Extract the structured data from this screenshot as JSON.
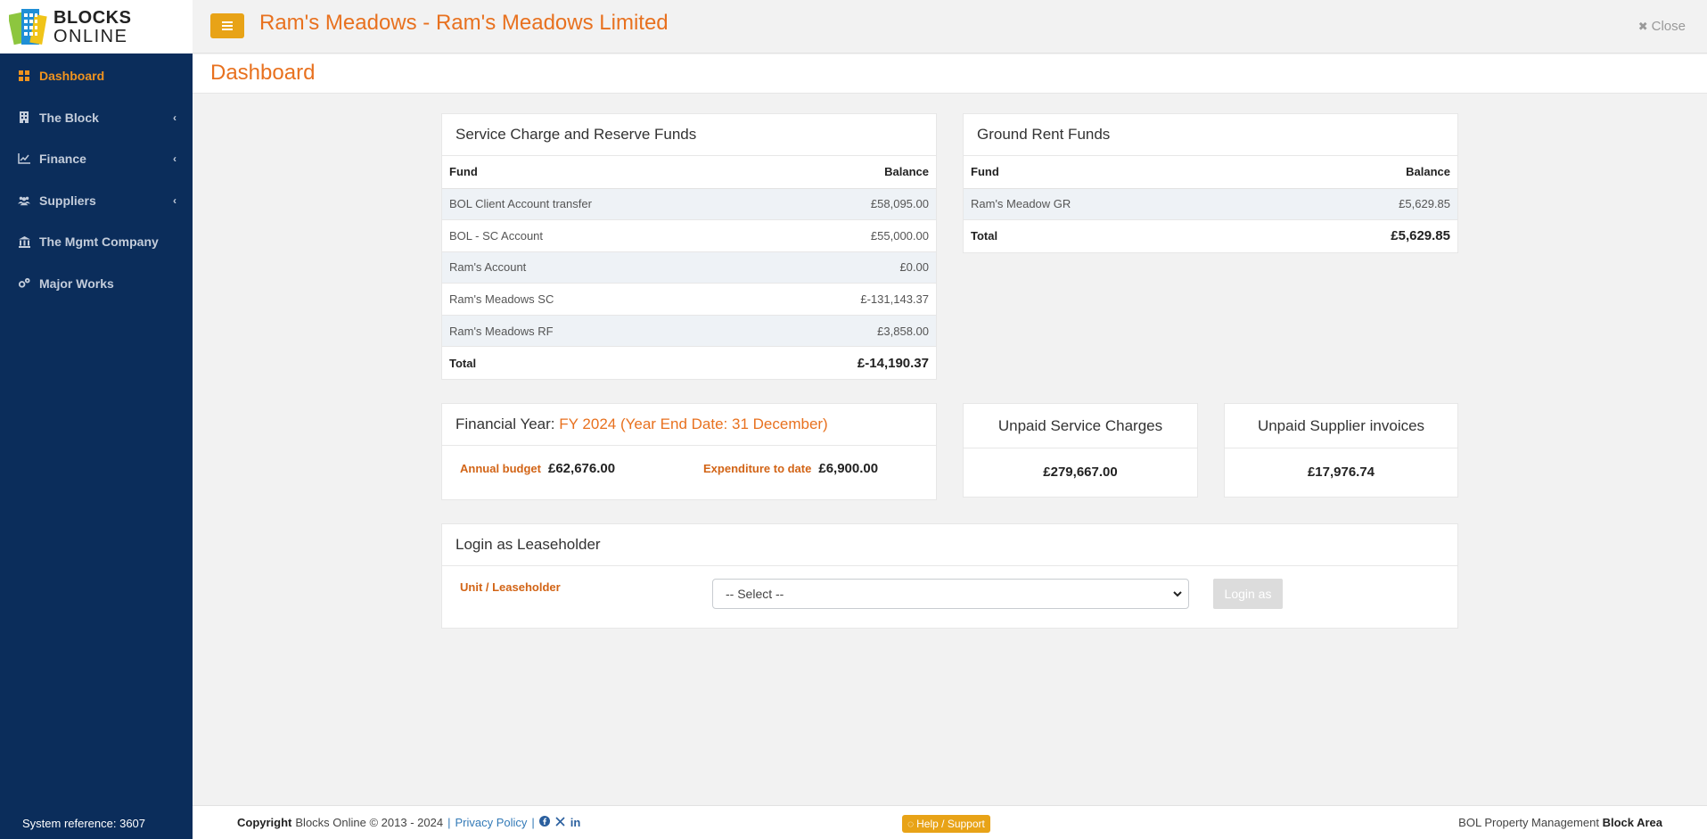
{
  "logo": {
    "line1": "BLOCKS",
    "line2": "ONLINE"
  },
  "sidebar": {
    "items": [
      {
        "label": "Dashboard",
        "icon": "grid-icon",
        "active": true
      },
      {
        "label": "The Block",
        "icon": "building-icon",
        "has_submenu": true
      },
      {
        "label": "Finance",
        "icon": "chart-icon",
        "has_submenu": true
      },
      {
        "label": "Suppliers",
        "icon": "users-icon",
        "has_submenu": true
      },
      {
        "label": "The Mgmt Company",
        "icon": "bank-icon"
      },
      {
        "label": "Major Works",
        "icon": "cogs-icon"
      }
    ],
    "system_reference": "System reference: 3607"
  },
  "header": {
    "title": "Ram's Meadows - Ram's Meadows Limited",
    "close_label": "Close"
  },
  "page_title": "Dashboard",
  "service_charge": {
    "title": "Service Charge and Reserve Funds",
    "col_fund": "Fund",
    "col_balance": "Balance",
    "rows": [
      {
        "fund": "BOL Client Account transfer",
        "balance": "£58,095.00"
      },
      {
        "fund": "BOL - SC Account",
        "balance": "£55,000.00"
      },
      {
        "fund": "Ram's Account",
        "balance": "£0.00"
      },
      {
        "fund": "Ram's Meadows SC",
        "balance": "£-131,143.37"
      },
      {
        "fund": "Ram's Meadows RF",
        "balance": "£3,858.00"
      }
    ],
    "total_label": "Total",
    "total_value": "£-14,190.37"
  },
  "ground_rent": {
    "title": "Ground Rent Funds",
    "col_fund": "Fund",
    "col_balance": "Balance",
    "rows": [
      {
        "fund": "Ram's Meadow GR",
        "balance": "£5,629.85"
      }
    ],
    "total_label": "Total",
    "total_value": "£5,629.85"
  },
  "financial_year": {
    "label": "Financial Year:",
    "value": "FY 2024 (Year End Date: 31 December)",
    "budget_label": "Annual budget",
    "budget_value": "£62,676.00",
    "expenditure_label": "Expenditure to date",
    "expenditure_value": "£6,900.00"
  },
  "unpaid_service": {
    "title": "Unpaid Service Charges",
    "value": "£279,667.00"
  },
  "unpaid_supplier": {
    "title": "Unpaid Supplier invoices",
    "value": "£17,976.74"
  },
  "login": {
    "title": "Login as Leaseholder",
    "field_label": "Unit / Leaseholder",
    "select_value": "-- Select --",
    "button_label": "Login as"
  },
  "footer": {
    "copyright_bold": "Copyright",
    "copyright_text": "Blocks Online © 2013 - 2024",
    "privacy_link": "Privacy Policy",
    "help_label": "Help / Support",
    "right_text": "BOL Property Management",
    "right_bold": "Block Area"
  },
  "colors": {
    "sidebar": "#0b2d5b",
    "accent": "#e8711f",
    "button": "#e8a317"
  }
}
